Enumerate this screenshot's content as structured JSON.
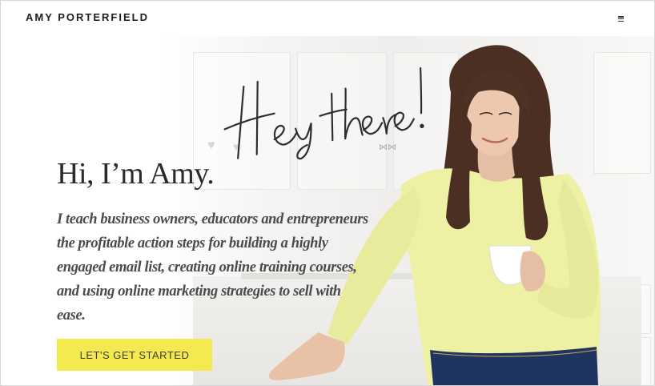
{
  "site": {
    "logo": "AMY PORTERFIELD",
    "menu_icon": "hamburger-menu-icon"
  },
  "hero": {
    "script_greeting": "Hey there!",
    "headline": "Hi, I’m Amy.",
    "intro": "I teach business owners, educators and entrepreneurs the profitable action steps for building a highly engaged email list, creating online training courses, and using online marketing strategies to sell with ease.",
    "cta_label": "LET'S GET STARTED",
    "colors": {
      "cta_background": "#f4e94f",
      "sweater": "#eef0a4",
      "jeans": "#1f3560"
    }
  }
}
